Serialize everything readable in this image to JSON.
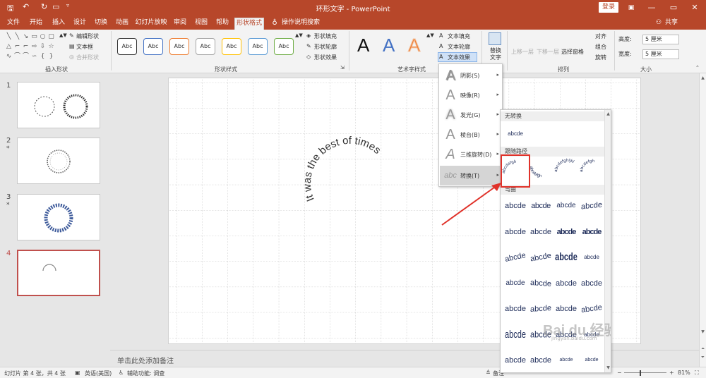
{
  "window": {
    "title": "环形文字 - PowerPoint",
    "login": "登录",
    "share": "共享",
    "minimize_glyph": "—",
    "restore_glyph": "▭",
    "close_glyph": "✕"
  },
  "tabs": [
    "文件",
    "开始",
    "插入",
    "设计",
    "切换",
    "动画",
    "幻灯片放映",
    "审阅",
    "视图",
    "帮助",
    "形状格式",
    "操作说明搜索"
  ],
  "active_tab": "形状格式",
  "ribbon": {
    "insert_shapes": {
      "label": "插入形状",
      "edit_shape": "编辑形状",
      "text_box": "文本框",
      "merge_shapes": "合并形状"
    },
    "shape_styles": {
      "label": "形状样式",
      "swatch_text": "Abc",
      "fill": "形状填充",
      "outline": "形状轮廓",
      "effects": "形状效果",
      "swatch_colors": [
        "#333333",
        "#4472c4",
        "#ed7d31",
        "#a5a5a5",
        "#ffc000",
        "#5b9bd5",
        "#70ad47"
      ]
    },
    "wordart": {
      "label": "艺术字样式",
      "letter": "A",
      "text_fill": "文本填充",
      "text_outline": "文本轮廓",
      "text_effects": "文本效果"
    },
    "alt_text": "替换文字",
    "arrange": {
      "label": "排列",
      "bring_forward": "上移一层",
      "send_backward": "下移一层",
      "selection_pane": "选择窗格",
      "align": "对齐",
      "group": "组合",
      "rotate": "旋转"
    },
    "size": {
      "label": "大小",
      "height_label": "高度:",
      "height_value": "5 厘米",
      "width_label": "宽度:",
      "width_value": "5 厘米"
    }
  },
  "slides": [
    {
      "number": "1",
      "star": ""
    },
    {
      "number": "2",
      "star": "*"
    },
    {
      "number": "3",
      "star": "*"
    },
    {
      "number": "4",
      "star": ""
    }
  ],
  "active_slide": "4",
  "slide_text": "It was the best of times",
  "notes_placeholder": "单击此处添加备注",
  "text_effects_menu": [
    {
      "label": "阴影(S)",
      "glyph": "A"
    },
    {
      "label": "映像(R)",
      "glyph": "A"
    },
    {
      "label": "发光(G)",
      "glyph": "A"
    },
    {
      "label": "棱台(B)",
      "glyph": "A"
    },
    {
      "label": "三维旋转(D)",
      "glyph": "A"
    },
    {
      "label": "转换(T)",
      "glyph": "abc"
    }
  ],
  "transform_gallery": {
    "no_transform": "无转换",
    "no_transform_sample": "abcde",
    "follow_path": "跟随路径",
    "warp": "弯曲",
    "sample": "abcde",
    "path_samples": [
      "abcdefgh",
      "abcdefgh",
      "abcdefghijkl",
      "abcdefgh"
    ]
  },
  "watermark": {
    "logo": "Bai du 经验",
    "url": "jingyan.baidu.com"
  },
  "status": {
    "slide_info": "幻灯片 第 4 张，共 4 张",
    "language": "英语(美国)",
    "accessibility": "辅助功能: 调查",
    "notes": "备注",
    "zoom": "81%"
  },
  "colors": {
    "accent": "#b7472a",
    "highlight_box": "#e0322a",
    "arrow": "#e0322a"
  }
}
